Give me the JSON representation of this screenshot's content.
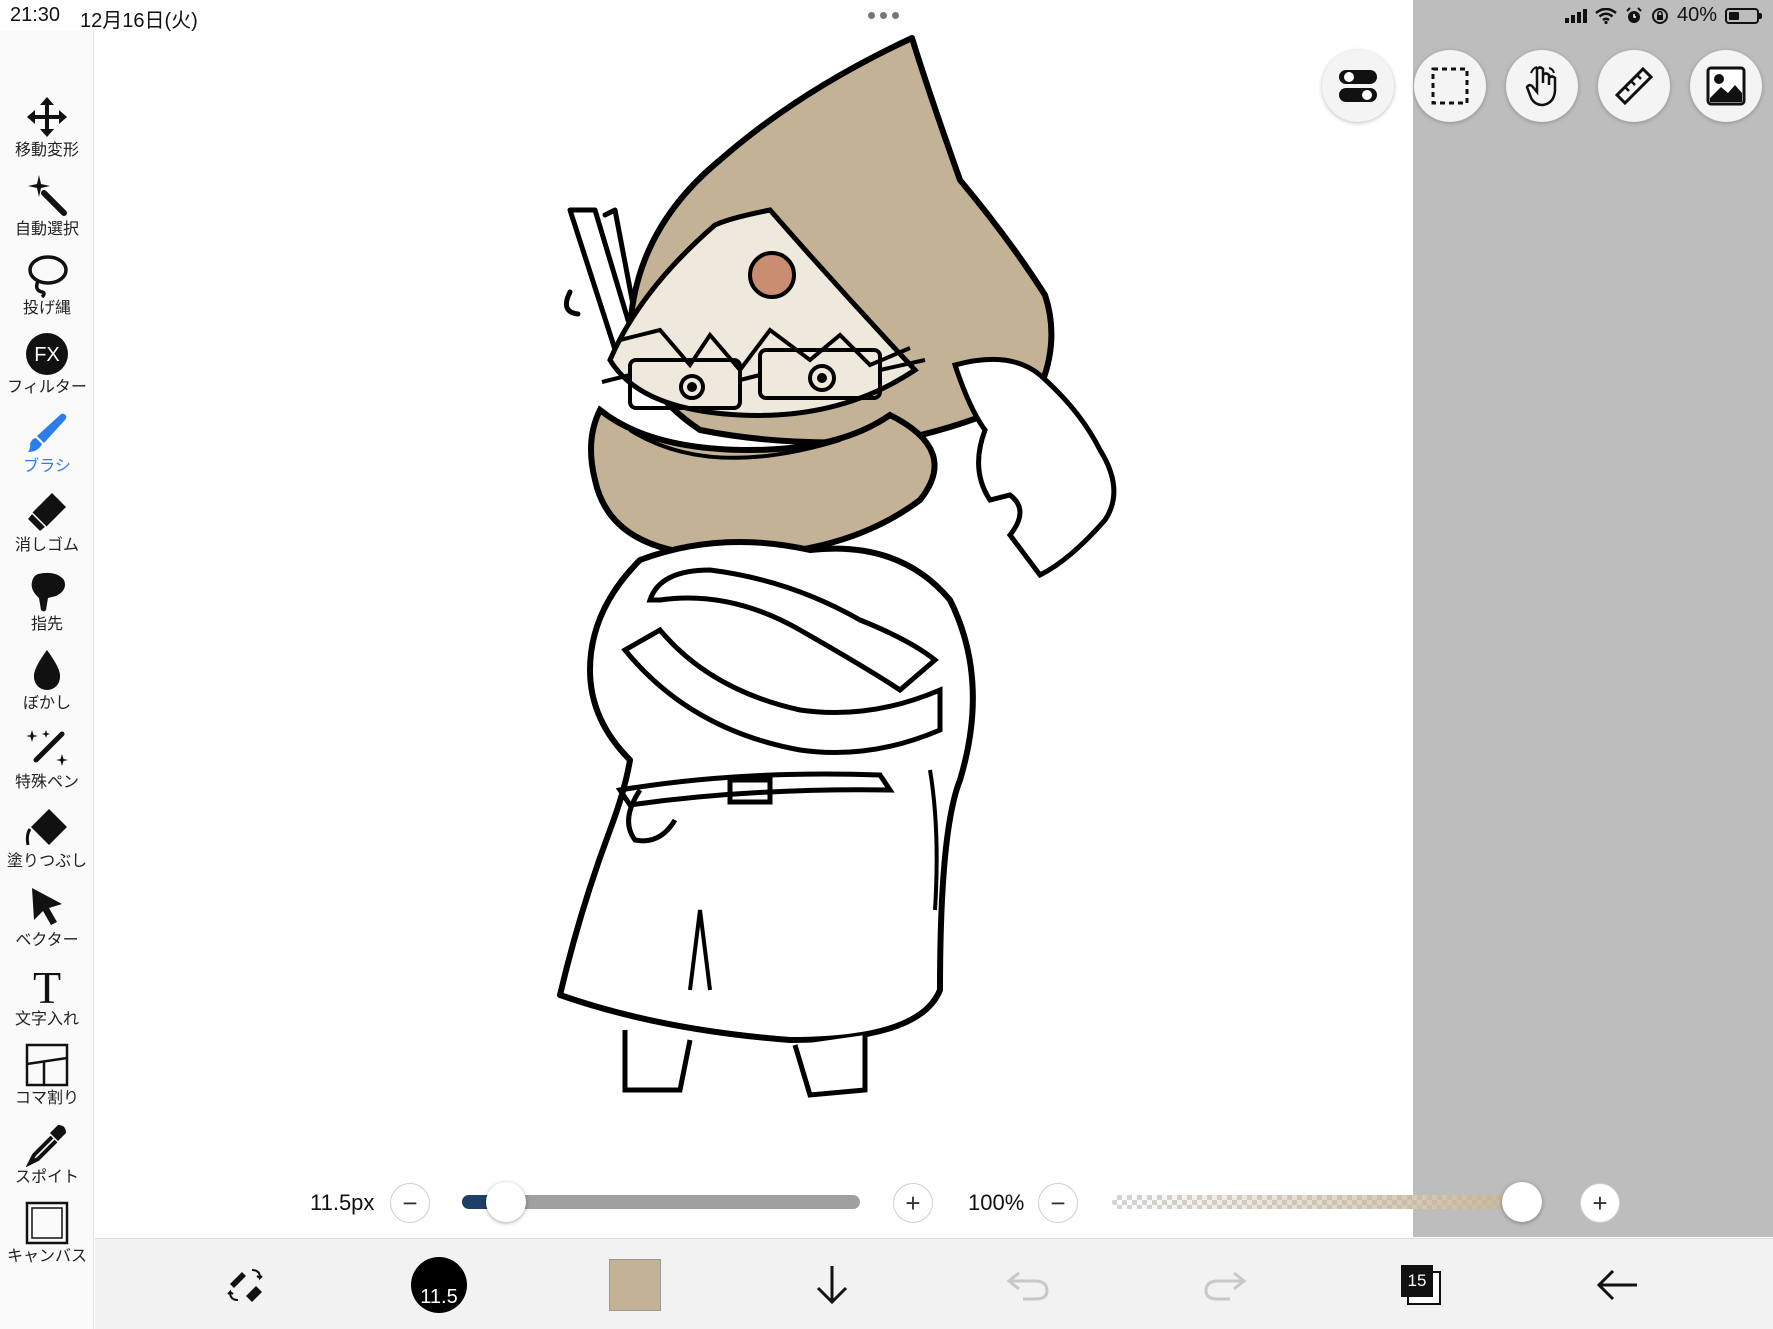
{
  "status_bar": {
    "time": "21:30",
    "date": "12月16日(火)",
    "battery": "40%",
    "battery_level": 0.4
  },
  "toolbar": {
    "tools": [
      {
        "label": "移動変形",
        "icon": "move-icon"
      },
      {
        "label": "自動選択",
        "icon": "magic-wand-icon"
      },
      {
        "label": "投げ縄",
        "icon": "lasso-icon"
      },
      {
        "label": "フィルター",
        "icon": "fx-icon",
        "glyph": "FX"
      },
      {
        "label": "ブラシ",
        "icon": "brush-icon",
        "active": true
      },
      {
        "label": "消しゴム",
        "icon": "eraser-icon"
      },
      {
        "label": "指先",
        "icon": "smudge-icon"
      },
      {
        "label": "ぼかし",
        "icon": "blur-drop-icon"
      },
      {
        "label": "特殊ペン",
        "icon": "special-pen-icon"
      },
      {
        "label": "塗りつぶし",
        "icon": "fill-bucket-icon"
      },
      {
        "label": "ベクター",
        "icon": "vector-arrow-icon"
      },
      {
        "label": "文字入れ",
        "icon": "text-icon",
        "glyph": "T"
      },
      {
        "label": "コマ割り",
        "icon": "panel-divide-icon"
      },
      {
        "label": "スポイト",
        "icon": "eyedropper-icon"
      },
      {
        "label": "キャンバス",
        "icon": "canvas-icon"
      }
    ]
  },
  "top_actions": [
    "toggle-switch-icon",
    "selection-icon",
    "touch-hand-icon",
    "ruler-icon",
    "image-icon"
  ],
  "brush_controls": {
    "size_label": "11.5px",
    "size_minus": "−",
    "size_plus": "+",
    "size_fraction": 0.06,
    "opacity_label": "100%",
    "opacity_minus": "−",
    "opacity_plus": "+",
    "opacity_fraction": 1.0
  },
  "bottom_bar": {
    "brush_size_value": "11.5",
    "current_color": "#c4b296",
    "layer_count": "15"
  },
  "colors": {
    "accent": "#2b7de9",
    "hood": "#c4b296",
    "workspace": "#bdbdbd"
  }
}
